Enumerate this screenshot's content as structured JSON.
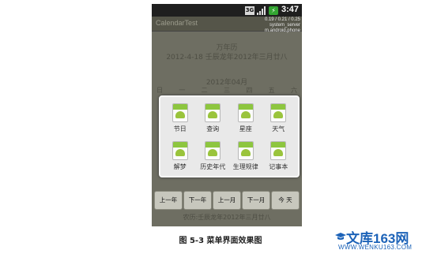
{
  "status_bar": {
    "network": "3G",
    "time": "3:47",
    "signal_icon": "signal-bars-icon",
    "battery_icon": "battery-charging-icon"
  },
  "app": {
    "title": "CalendarTest"
  },
  "perf_overlay": {
    "line1": "0.19 / 0.21 / 0.25",
    "line2": "system_server",
    "line3": "m.android.phone"
  },
  "calendar": {
    "almanac_title": "万年历",
    "date_line": "2012-4-18  壬辰龙年2012年三月廿八",
    "month_title": "2012年04月",
    "weekdays": [
      "日",
      "一",
      "二",
      "三",
      "四",
      "五",
      "六"
    ]
  },
  "menu": {
    "icon": "android-app-icon",
    "items": [
      {
        "label": "节日"
      },
      {
        "label": "查询"
      },
      {
        "label": "星座"
      },
      {
        "label": "天气"
      },
      {
        "label": "解梦"
      },
      {
        "label": "历史年代"
      },
      {
        "label": "生理规律"
      },
      {
        "label": "记事本"
      }
    ]
  },
  "nav_buttons": [
    {
      "label": "上一年"
    },
    {
      "label": "下一年"
    },
    {
      "label": "上一月"
    },
    {
      "label": "下一月"
    },
    {
      "label": "今 天"
    }
  ],
  "lunar_footer": "农历:壬辰龙年2012年三月廿八",
  "caption": "图 5-3  菜单界面效果图",
  "watermark": {
    "text": "文库163网",
    "url": "WWW.WENKU163.COM"
  },
  "colors": {
    "accent_green": "#8dc63f",
    "screen_bg": "#6e6e62",
    "watermark_blue": "#1d63b8"
  }
}
